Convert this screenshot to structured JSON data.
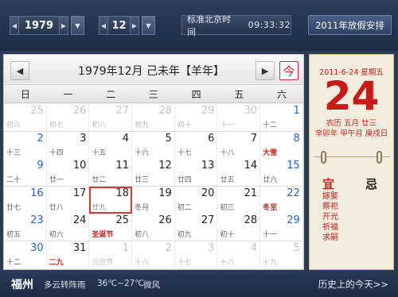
{
  "toolbar": {
    "year": "1979",
    "month": "12",
    "time_label": "标准北京时间",
    "time_value": "09:33:32",
    "holiday_button": "2011年放假安排"
  },
  "calendar": {
    "title": "1979年12月  己未年【羊年】",
    "today_button": "今",
    "weekdays": [
      "日",
      "一",
      "二",
      "三",
      "四",
      "五",
      "六"
    ],
    "weeks": [
      [
        {
          "d": "25",
          "l": "初六",
          "other": true,
          "wkend": true
        },
        {
          "d": "26",
          "l": "初七",
          "other": true
        },
        {
          "d": "27",
          "l": "初八",
          "other": true
        },
        {
          "d": "28",
          "l": "初九",
          "other": true
        },
        {
          "d": "29",
          "l": "初十",
          "other": true
        },
        {
          "d": "30",
          "l": "十一",
          "other": true
        },
        {
          "d": "1",
          "l": "十二",
          "wkend": true
        }
      ],
      [
        {
          "d": "2",
          "l": "十三",
          "wkend": true
        },
        {
          "d": "3",
          "l": "十四"
        },
        {
          "d": "4",
          "l": "十五"
        },
        {
          "d": "5",
          "l": "十六"
        },
        {
          "d": "6",
          "l": "十七"
        },
        {
          "d": "7",
          "l": "十八"
        },
        {
          "d": "8",
          "l": "大雪",
          "wkend": true,
          "red": true
        }
      ],
      [
        {
          "d": "9",
          "l": "二十",
          "wkend": true
        },
        {
          "d": "10",
          "l": "廿一"
        },
        {
          "d": "11",
          "l": "廿二"
        },
        {
          "d": "12",
          "l": "廿三"
        },
        {
          "d": "13",
          "l": "廿四"
        },
        {
          "d": "14",
          "l": "廿五"
        },
        {
          "d": "15",
          "l": "廿六",
          "wkend": true
        }
      ],
      [
        {
          "d": "16",
          "l": "廿七",
          "wkend": true
        },
        {
          "d": "17",
          "l": "廿八"
        },
        {
          "d": "18",
          "l": "廿九",
          "today": true
        },
        {
          "d": "19",
          "l": "冬月"
        },
        {
          "d": "20",
          "l": "初二"
        },
        {
          "d": "21",
          "l": "初三"
        },
        {
          "d": "22",
          "l": "冬至",
          "wkend": true,
          "red": true
        }
      ],
      [
        {
          "d": "23",
          "l": "初五",
          "wkend": true
        },
        {
          "d": "24",
          "l": "初六"
        },
        {
          "d": "25",
          "l": "圣诞节",
          "red": true
        },
        {
          "d": "26",
          "l": "初八"
        },
        {
          "d": "27",
          "l": "初九"
        },
        {
          "d": "28",
          "l": "初十"
        },
        {
          "d": "29",
          "l": "十一",
          "wkend": true
        }
      ],
      [
        {
          "d": "30",
          "l": "十二",
          "wkend": true
        },
        {
          "d": "31",
          "l": "二九",
          "red": true
        },
        {
          "d": "1",
          "l": "元旦节",
          "other": true
        },
        {
          "d": "2",
          "l": "十六",
          "other": true
        },
        {
          "d": "3",
          "l": "十七",
          "other": true
        },
        {
          "d": "4",
          "l": "十八",
          "other": true
        },
        {
          "d": "5",
          "l": "十九",
          "other": true,
          "wkend": true
        }
      ]
    ]
  },
  "almanac": {
    "date_line": "2011-6-24 星期五",
    "day": "24",
    "lunar_line1": "农历 五月 廿三",
    "lunar_line2": "辛卯年 甲午月 庚戌日",
    "yi_label": "宜",
    "ji_label": "忌",
    "yi_items": [
      "嫁娶",
      "祭祀",
      "开光",
      "祈福",
      "求嗣"
    ]
  },
  "footer": {
    "city": "福州",
    "weather": "多云转阵雨",
    "temp": "36℃~27℃",
    "wind": "微风",
    "history": "历史上的今天>>"
  }
}
